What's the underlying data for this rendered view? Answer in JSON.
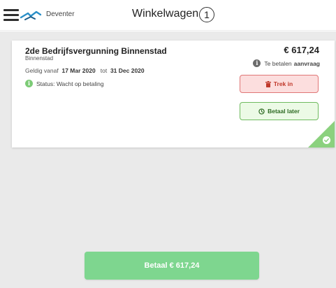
{
  "header": {
    "city": "Deventer",
    "title": "Winkelwagen",
    "item_count": "1"
  },
  "cart_item": {
    "name": "2de Bedrijfsvergunning Binnenstad",
    "area": "Binnenstad",
    "valid_from_label": "Geldig vanaf",
    "valid_from": "17 Mar 2020",
    "valid_to_label": "tot",
    "valid_to": "31 Dec 2020",
    "status_text": "Status: Wacht op betaling",
    "price": "€ 617,24",
    "pay_note_prefix": "Te betalen",
    "pay_note_bold": "aanvraag",
    "withdraw_label": "Trek in",
    "pay_later_label": "Betaal later"
  },
  "footer": {
    "pay_button_label": "Betaal € 617,24"
  },
  "colors": {
    "accent_green": "#7ed68f",
    "withdraw_red": "#e07676",
    "corner_green": "#8bd17e"
  },
  "icons": [
    "menu-icon",
    "logo-icon",
    "info-icon",
    "trash-icon",
    "clock-icon",
    "check-icon"
  ]
}
